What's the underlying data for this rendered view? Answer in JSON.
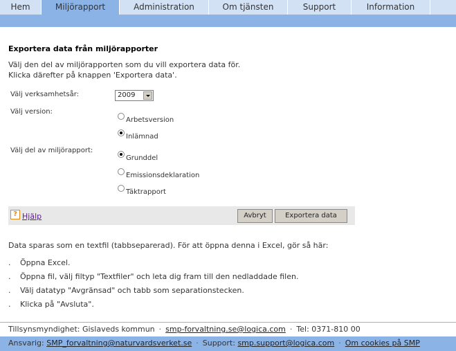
{
  "nav": {
    "items": [
      {
        "label": "Hem",
        "active": false
      },
      {
        "label": "Miljörapport",
        "active": true
      },
      {
        "label": "Administration",
        "active": false
      },
      {
        "label": "Om tjänsten",
        "active": false
      },
      {
        "label": "Support",
        "active": false
      },
      {
        "label": "Information",
        "active": false
      }
    ]
  },
  "page": {
    "title": "Exportera data från miljörapporter",
    "intro_line1": "Välj den del av miljörapporten som du vill exportera data för.",
    "intro_line2": "Klicka därefter på knappen 'Exportera data'."
  },
  "form": {
    "year_label": "Välj verksamhetsår:",
    "year_value": "2009",
    "version_label": "Välj version:",
    "version_options": [
      {
        "label": "Arbetsversion",
        "checked": false
      },
      {
        "label": "Inlämnad",
        "checked": true
      }
    ],
    "part_label": "Välj del av miljörapport:",
    "part_options": [
      {
        "label": "Grunddel",
        "checked": true
      },
      {
        "label": "Emissionsdeklaration",
        "checked": false
      },
      {
        "label": "Täktrapport",
        "checked": false
      }
    ]
  },
  "actions": {
    "help_icon": "?",
    "help_label": "Hjälp",
    "cancel_label": "Avbryt",
    "export_label": "Exportera data"
  },
  "info": {
    "text": "Data sparas som en textfil (tabbseparerad). För att öppna denna i Excel, gör så här:",
    "bullet": ".",
    "steps": [
      "Öppna Excel.",
      "Öppna fil, välj filtyp \"Textfiler\" och leta dig fram till den nedladdade filen.",
      "Välj datatyp \"Avgränsad\" och tabb som separationstecken.",
      "Klicka på \"Avsluta\"."
    ]
  },
  "footer": {
    "authority": "Tillsynsmyndighet: Gislaveds kommun",
    "authority_email": "smp-forvaltning.se@logica.com",
    "phone": "Tel: 0371-810 00",
    "responsible_label": "Ansvarig:",
    "responsible_email": "SMP_forvaltning@naturvardsverket.se",
    "support_label": "Support:",
    "support_email": "smp.support@logica.com",
    "cookies_link": "Om cookies på SMP",
    "separator": "·"
  },
  "colors": {
    "nav_bg": "#d3e1f4",
    "nav_active": "#8cb3e6",
    "help_accent": "#e08a1a"
  }
}
